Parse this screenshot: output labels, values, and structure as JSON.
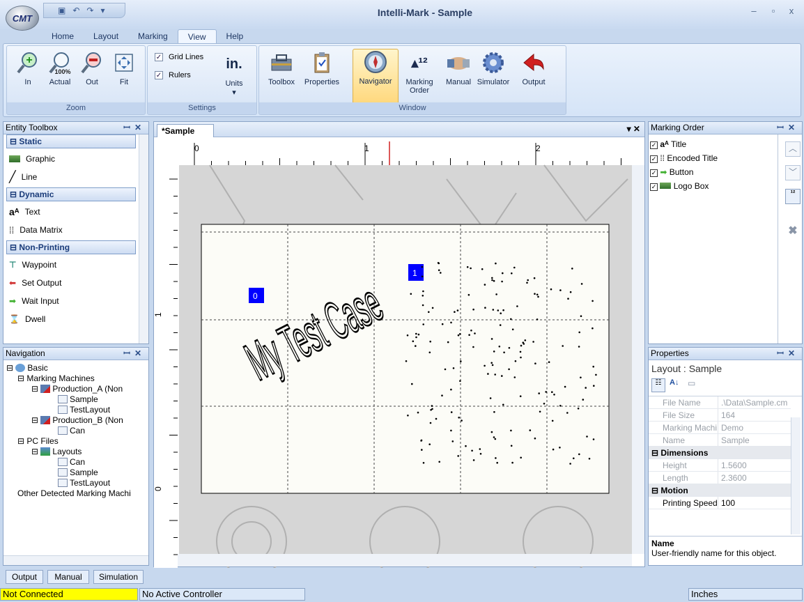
{
  "app": {
    "logo": "CMT",
    "title": "Intelli-Mark - Sample"
  },
  "menu_tabs": [
    {
      "label": "Home"
    },
    {
      "label": "Layout"
    },
    {
      "label": "Marking"
    },
    {
      "label": "View"
    },
    {
      "label": "Help"
    }
  ],
  "ribbon": {
    "zoom": {
      "label": "Zoom",
      "buttons": [
        {
          "label": "In",
          "icon": "zoom-in-icon"
        },
        {
          "label": "Actual",
          "icon": "zoom-actual-icon",
          "badge": "100%"
        },
        {
          "label": "Out",
          "icon": "zoom-out-icon"
        },
        {
          "label": "Fit",
          "icon": "zoom-fit-icon"
        }
      ]
    },
    "settings": {
      "label": "Settings",
      "grid_lines": "Grid Lines",
      "rulers": "Rulers",
      "units_label": "Units",
      "units_glyph": "in."
    },
    "window": {
      "label": "Window",
      "buttons": [
        {
          "label": "Toolbox"
        },
        {
          "label": "Properties"
        },
        {
          "label": "Navigator"
        },
        {
          "label": "Marking Order"
        },
        {
          "label": "Manual"
        },
        {
          "label": "Simulator"
        },
        {
          "label": "Output"
        }
      ]
    }
  },
  "entity_toolbox": {
    "title": "Entity Toolbox",
    "groups": [
      {
        "header": "Static",
        "items": [
          "Graphic",
          "Line"
        ]
      },
      {
        "header": "Dynamic",
        "items": [
          "Text",
          "Data Matrix"
        ]
      },
      {
        "header": "Non-Printing",
        "items": [
          "Waypoint",
          "Set Output",
          "Wait Input",
          "Dwell"
        ]
      }
    ]
  },
  "navigation": {
    "title": "Navigation",
    "tree": {
      "basic": "Basic",
      "marking_machines": "Marking Machines",
      "production_a": "Production_A (Non",
      "sample": "Sample",
      "testlayout": "TestLayout",
      "production_b": "Production_B (Non",
      "can": "Can",
      "pc_files": "PC Files",
      "layouts": "Layouts",
      "other": "Other Detected Marking Machi"
    }
  },
  "document": {
    "tab": "*Sample",
    "ruler_h": [
      "0",
      "1",
      "2"
    ],
    "ruler_v": [
      "1",
      "0"
    ],
    "canvas_text": "My Test Case",
    "badges": [
      "0",
      "1"
    ]
  },
  "marking_order": {
    "title": "Marking Order",
    "items": [
      "Title",
      "Encoded Title",
      "Button",
      "Logo Box"
    ]
  },
  "properties": {
    "title": "Properties",
    "object": "Layout : Sample",
    "rows": [
      {
        "k": "File Name",
        "v": ".\\Data\\Sample.cm"
      },
      {
        "k": "File Size",
        "v": "164"
      },
      {
        "k": "Marking Machi",
        "v": "Demo"
      },
      {
        "k": "Name",
        "v": "Sample"
      }
    ],
    "dimensions": {
      "header": "Dimensions",
      "rows": [
        {
          "k": "Height",
          "v": "1.5600"
        },
        {
          "k": "Length",
          "v": "2.3600"
        }
      ]
    },
    "motion": {
      "header": "Motion",
      "rows": [
        {
          "k": "Printing Speed",
          "v": "100"
        }
      ]
    },
    "desc_title": "Name",
    "desc_text": "User-friendly name for this object."
  },
  "bottom_tabs": [
    "Output",
    "Manual",
    "Simulation"
  ],
  "status": {
    "connection": "Not Connected",
    "controller": "No Active Controller",
    "units": "Inches"
  },
  "colors": {
    "not_connected": "#ffff00",
    "badge": "#0000ff",
    "accent": "#c7d8ee"
  }
}
